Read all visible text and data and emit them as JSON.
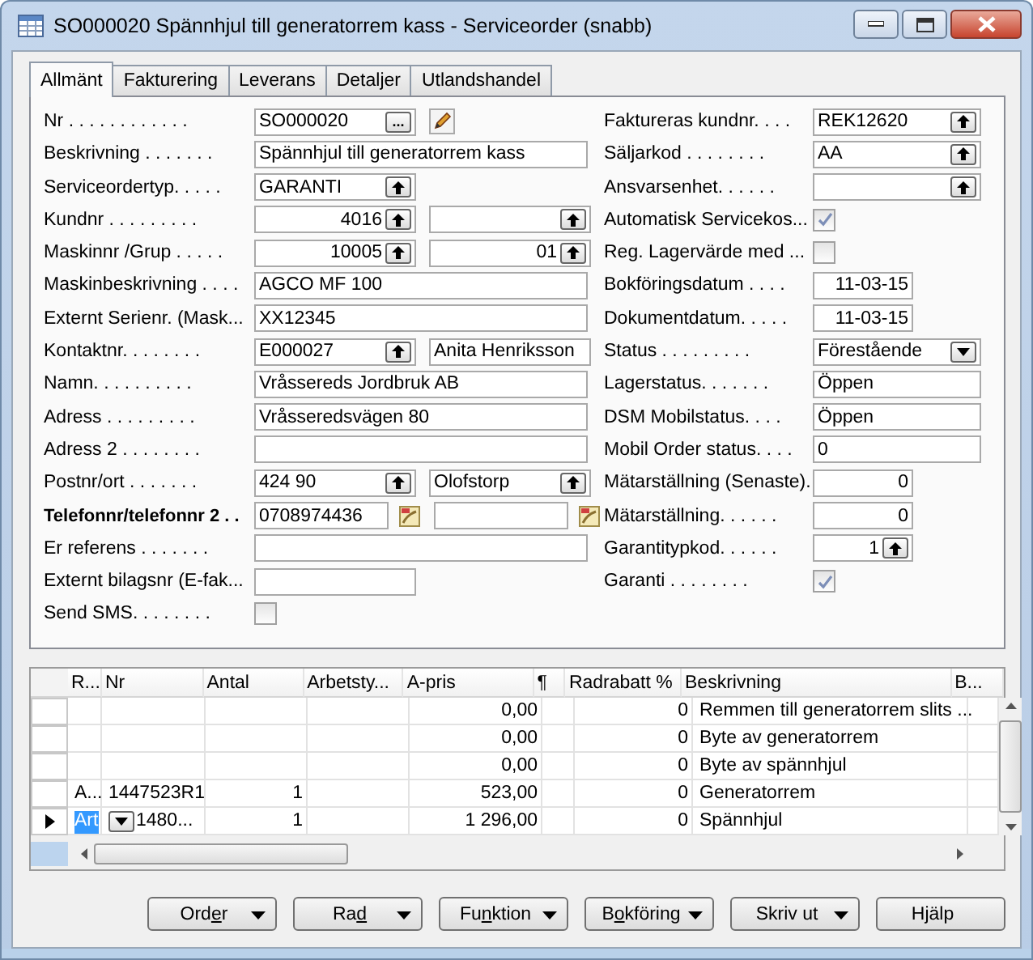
{
  "window": {
    "title": "SO000020 Spännhjul till generatorrem kass - Serviceorder (snabb)"
  },
  "tabs": [
    {
      "label": "Allmänt",
      "selected": true
    },
    {
      "label": "Fakturering",
      "selected": false
    },
    {
      "label": "Leverans",
      "selected": false
    },
    {
      "label": "Detaljer",
      "selected": false
    },
    {
      "label": "Utlandshandel",
      "selected": false
    }
  ],
  "left_fields": [
    {
      "label": "Nr . . . . . . . . . . . .",
      "controls": [
        {
          "kind": "assist",
          "value": "SO000020",
          "button_text": "..."
        }
      ]
    },
    {
      "label": "Beskrivning . . . . . . .",
      "controls": [
        {
          "kind": "text",
          "value": "Spännhjul till generatorrem kass"
        }
      ]
    },
    {
      "label": "Serviceordertyp. . . . .",
      "controls": [
        {
          "kind": "lookup",
          "value": "GARANTI"
        }
      ]
    },
    {
      "label": "Kundnr . . . . . . . . .",
      "controls": [
        {
          "kind": "lookup_number",
          "value": "4016"
        },
        {
          "kind": "lookup_number"
        }
      ]
    },
    {
      "label": "Maskinnr /Grup . . . . .",
      "controls": [
        {
          "kind": "lookup_number",
          "value": "10005"
        },
        {
          "kind": "lookup_number",
          "value": "01"
        }
      ]
    },
    {
      "label": "Maskinbeskrivning . . . .",
      "controls": [
        {
          "kind": "text",
          "value": "AGCO MF 100"
        }
      ]
    },
    {
      "label": "Externt Serienr. (Mask...",
      "controls": [
        {
          "kind": "text",
          "value": "XX12345"
        }
      ]
    },
    {
      "label": "Kontaktnr. . . . . . . .",
      "controls": [
        {
          "kind": "lookup",
          "value": "E000027"
        },
        {
          "kind": "text",
          "value": "Anita Henriksson"
        }
      ]
    },
    {
      "label": "Namn. . . . . . . . . .",
      "controls": [
        {
          "kind": "text",
          "value": "Vråssereds Jordbruk AB"
        }
      ]
    },
    {
      "label": "Adress . . . . . . . . .",
      "controls": [
        {
          "kind": "text",
          "value": "Vråsseredsvägen 80"
        }
      ]
    },
    {
      "label": "Adress 2 . . . . . . . .",
      "controls": [
        {
          "kind": "text"
        }
      ]
    },
    {
      "label": "Postnr/ort . . . . . . .",
      "controls": [
        {
          "kind": "lookup",
          "value": "424 90"
        },
        {
          "kind": "lookup",
          "value": "Olofstorp"
        }
      ]
    },
    {
      "label": "Telefonnr/telefonnr 2 . .",
      "emphasis": true,
      "controls": [
        {
          "kind": "phone",
          "value": "0708974436"
        },
        {
          "kind": "phone"
        }
      ]
    },
    {
      "label": "Er referens . . . . . . .",
      "controls": [
        {
          "kind": "text"
        }
      ]
    },
    {
      "label": "Externt bilagsnr (E-fak...",
      "controls": [
        {
          "kind": "short_text"
        }
      ]
    },
    {
      "label": "Send SMS. . . . . . . .",
      "controls": [
        {
          "kind": "check",
          "checked": false
        }
      ]
    }
  ],
  "right_fields": [
    {
      "label": "Faktureras kundnr. . . .",
      "controls": [
        {
          "kind": "lookup",
          "value": "REK12620"
        }
      ]
    },
    {
      "label": "Säljarkod . . . . . . . .",
      "controls": [
        {
          "kind": "lookup",
          "value": "AA"
        }
      ]
    },
    {
      "label": "Ansvarsenhet. . . . . .",
      "controls": [
        {
          "kind": "lookup"
        }
      ]
    },
    {
      "label": "Automatisk Servicekos...",
      "controls": [
        {
          "kind": "check",
          "checked": true
        }
      ]
    },
    {
      "label": "Reg. Lagervärde med ...",
      "controls": [
        {
          "kind": "check",
          "checked": false
        }
      ]
    },
    {
      "label": "Bokföringsdatum . . . .",
      "controls": [
        {
          "kind": "number",
          "value": "11-03-15"
        }
      ]
    },
    {
      "label": "Dokumentdatum. . . . .",
      "controls": [
        {
          "kind": "number",
          "value": "11-03-15"
        }
      ]
    },
    {
      "label": "Status . . . . . . . . .",
      "controls": [
        {
          "kind": "dropdown",
          "value": "Förestående"
        }
      ]
    },
    {
      "label": "Lagerstatus. . . . . . .",
      "controls": [
        {
          "kind": "text",
          "value": "Öppen"
        }
      ]
    },
    {
      "label": "DSM Mobilstatus. . . .",
      "controls": [
        {
          "kind": "text",
          "value": "Öppen"
        }
      ]
    },
    {
      "label": "Mobil Order status. . . .",
      "controls": [
        {
          "kind": "text",
          "value": "0"
        }
      ]
    },
    {
      "label": "Mätarställning (Senaste).",
      "controls": [
        {
          "kind": "number",
          "value": "0"
        }
      ]
    },
    {
      "label": "Mätarställning. . . . . .",
      "controls": [
        {
          "kind": "number",
          "value": "0"
        }
      ]
    },
    {
      "label": "Garantitypkod. . . . . .",
      "controls": [
        {
          "kind": "lookup_number",
          "value": "1"
        }
      ]
    },
    {
      "label": "Garanti . . . . . . . .",
      "controls": [
        {
          "kind": "check",
          "checked": true
        }
      ]
    }
  ],
  "lines": {
    "columns": [
      "R...",
      "Nr",
      "Antal",
      "Arbetsty...",
      "A-pris",
      "¶",
      "Radrabatt %",
      "Beskrivning",
      "B..."
    ],
    "rows": [
      {
        "kind": "line",
        "current": false,
        "cells": [
          null,
          null,
          null,
          null,
          "0,00",
          null,
          "0",
          "Remmen till generatorrem slits ...",
          null
        ]
      },
      {
        "kind": "line",
        "current": false,
        "cells": [
          null,
          null,
          null,
          null,
          "0,00",
          null,
          "0",
          "Byte av generatorrem",
          null
        ]
      },
      {
        "kind": "line",
        "current": false,
        "cells": [
          null,
          null,
          null,
          null,
          "0,00",
          null,
          "0",
          "Byte av spännhjul",
          null
        ]
      },
      {
        "kind": "line",
        "current": false,
        "cells": [
          "A...",
          "1447523R1",
          "1",
          null,
          "523,00",
          null,
          "0",
          "Generatorrem",
          null
        ]
      },
      {
        "kind": "line",
        "current": true,
        "cells": [
          "Art",
          "1480...",
          "1",
          null,
          "1 296,00",
          null,
          "0",
          "Spännhjul",
          null
        ]
      },
      {
        "kind": "new",
        "current": false
      }
    ]
  },
  "buttons": [
    {
      "pre": "Ord",
      "key": "e",
      "post": "r",
      "menu": true
    },
    {
      "pre": "Ra",
      "key": "d",
      "menu": true
    },
    {
      "pre": "Fu",
      "key": "n",
      "post": "ktion",
      "menu": true
    },
    {
      "pre": "B",
      "key": "o",
      "post": "kföring",
      "menu": true
    },
    {
      "pre": "Skriv ut",
      "menu": true
    },
    {
      "pre": "Hjälp",
      "menu": false
    }
  ]
}
